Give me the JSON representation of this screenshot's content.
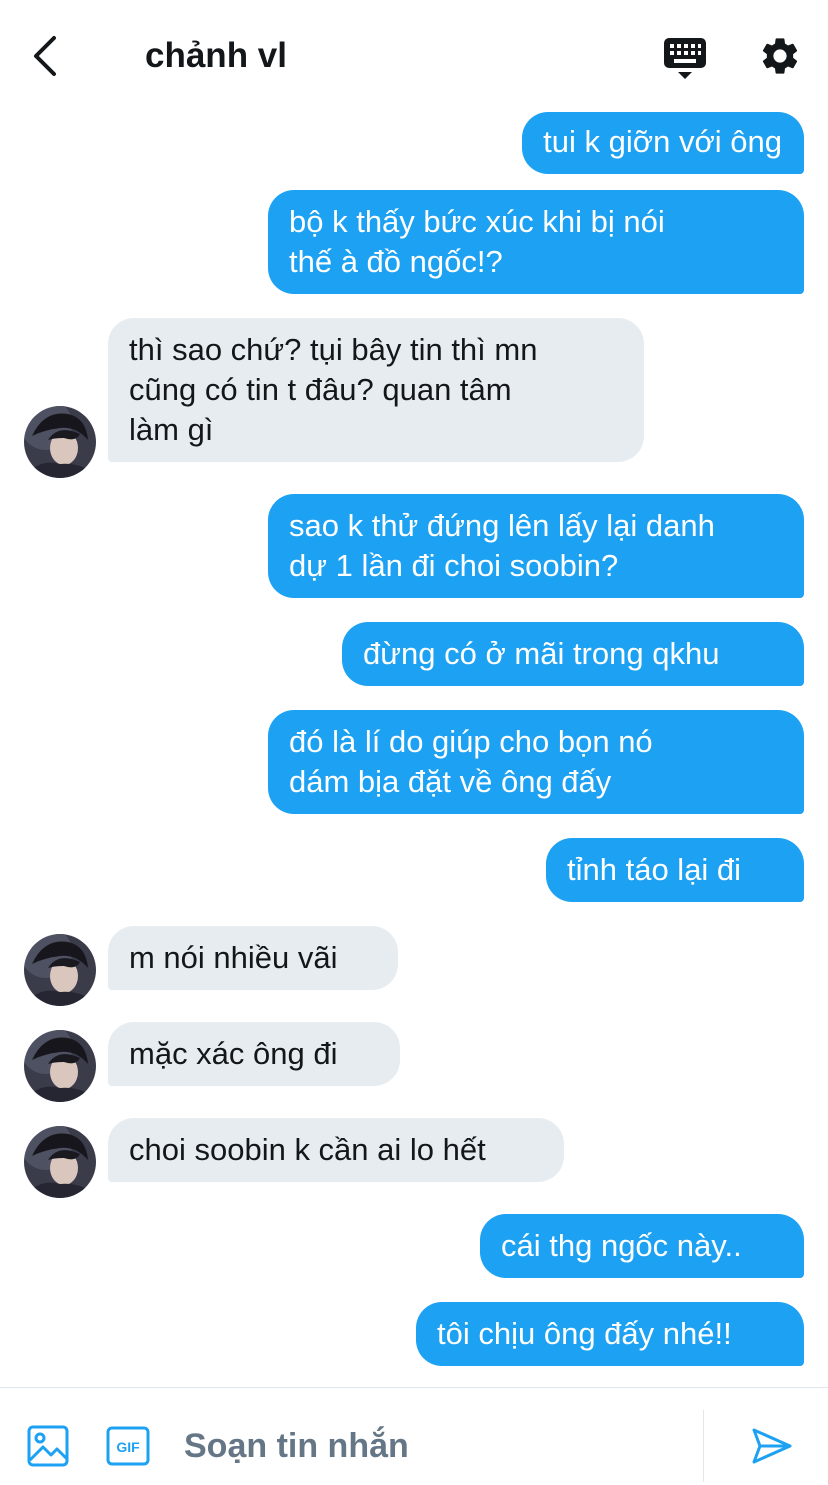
{
  "header": {
    "title": "chảnh vl",
    "back_icon": "chevron-left-icon",
    "keyboard_icon": "keyboard-icon",
    "settings_icon": "gear-icon"
  },
  "colors": {
    "outgoing_bubble": "#1da1f2",
    "incoming_bubble": "#e6ecf0",
    "accent": "#1da1f2",
    "placeholder": "#657786"
  },
  "messages": [
    {
      "direction": "out",
      "lines": [
        "tui k giỡn với ông"
      ]
    },
    {
      "direction": "out",
      "lines": [
        "bộ k thấy bức xúc khi bị nói",
        "thế à đồ ngốc!?"
      ]
    },
    {
      "direction": "in",
      "lines": [
        "thì sao chứ? tụi bây tin thì mn",
        "cũng có tin t đâu? quan tâm",
        "làm gì"
      ]
    },
    {
      "direction": "out",
      "lines": [
        "sao k thử đứng lên lấy lại danh",
        "dự 1 lần đi choi soobin?"
      ]
    },
    {
      "direction": "out",
      "lines": [
        "đừng có ở mãi trong qkhu"
      ]
    },
    {
      "direction": "out",
      "lines": [
        "đó là lí do giúp cho bọn nó",
        "dám bịa đặt về ông đấy"
      ]
    },
    {
      "direction": "out",
      "lines": [
        "tỉnh táo lại đi"
      ]
    },
    {
      "direction": "in",
      "lines": [
        "m nói nhiều vãi"
      ]
    },
    {
      "direction": "in",
      "lines": [
        "mặc xác ông đi"
      ]
    },
    {
      "direction": "in",
      "lines": [
        "choi soobin k cần ai lo hết"
      ]
    },
    {
      "direction": "out",
      "lines": [
        "cái thg ngốc này.."
      ]
    },
    {
      "direction": "out",
      "lines": [
        "tôi chịu ông đấy nhé!!"
      ]
    }
  ],
  "composer": {
    "placeholder": "Soạn tin nhắn",
    "media_icon": "image-icon",
    "gif_icon": "gif-icon",
    "gif_label": "GIF",
    "send_icon": "send-icon"
  }
}
